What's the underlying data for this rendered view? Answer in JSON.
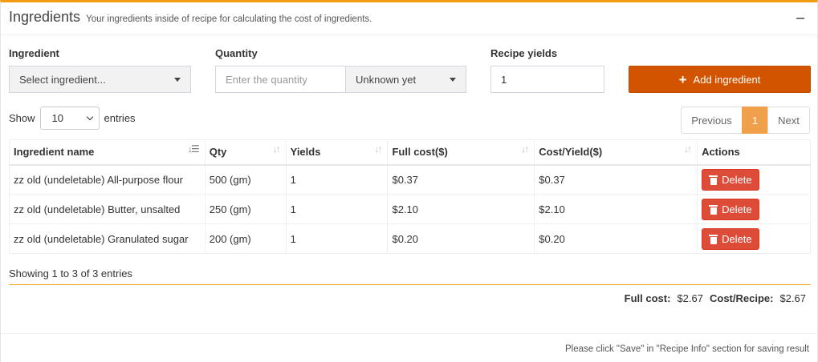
{
  "header": {
    "title": "Ingredients",
    "subtitle": "Your ingredients inside of recipe for calculating the cost of ingredients."
  },
  "form": {
    "ingredient_label": "Ingredient",
    "ingredient_value": "Select ingredient...",
    "quantity_label": "Quantity",
    "quantity_placeholder": "Enter the quantity",
    "unit_value": "Unknown yet",
    "yields_label": "Recipe yields",
    "yields_value": "1",
    "add_label": "Add ingredient"
  },
  "list_controls": {
    "show_label": "Show",
    "entries_value": "10",
    "entries_label": "entries",
    "prev_label": "Previous",
    "page": "1",
    "next_label": "Next"
  },
  "table": {
    "headers": [
      "Ingredient name",
      "Qty",
      "Yields",
      "Full cost($)",
      "Cost/Yield($)",
      "Actions"
    ],
    "rows": [
      {
        "name": "zz old (undeletable) All-purpose flour",
        "qty": "500 (gm)",
        "yields": "1",
        "full_cost": "$0.37",
        "cost_yield": "$0.37",
        "action": "Delete"
      },
      {
        "name": "zz old (undeletable) Butter, unsalted",
        "qty": "250 (gm)",
        "yields": "1",
        "full_cost": "$2.10",
        "cost_yield": "$2.10",
        "action": "Delete"
      },
      {
        "name": "zz old (undeletable) Granulated sugar",
        "qty": "200 (gm)",
        "yields": "1",
        "full_cost": "$0.20",
        "cost_yield": "$0.20",
        "action": "Delete"
      }
    ]
  },
  "summary": {
    "showing": "Showing 1 to 3 of 3 entries",
    "full_cost_label": "Full cost:",
    "full_cost_value": "$2.67",
    "cost_recipe_label": "Cost/Recipe:",
    "cost_recipe_value": "$2.67"
  },
  "footer": {
    "note": "Please click \"Save\" in \"Recipe Info\" section for saving result"
  },
  "colors": {
    "accent": "#f39c12",
    "add_button": "#d35400",
    "delete_button": "#dd4b39",
    "active_page": "#f0a04a"
  }
}
